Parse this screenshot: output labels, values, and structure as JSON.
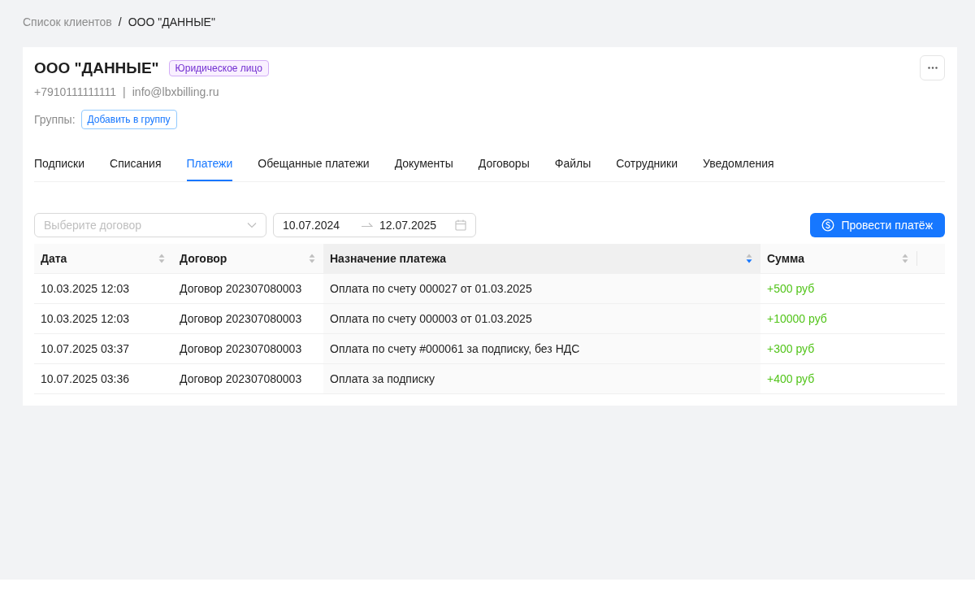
{
  "breadcrumb": {
    "separator": "/",
    "items": [
      {
        "label": "Список клиентов",
        "current": false
      },
      {
        "label": "ООО \"ДАННЫЕ\"",
        "current": true
      }
    ]
  },
  "client": {
    "name": "ООО \"ДАННЫЕ\"",
    "type_badge": "Юридическое лицо",
    "phone": "+7910111111111",
    "contact_separator": "|",
    "email": "info@lbxbilling.ru",
    "groups_label": "Группы:",
    "add_group_button": "Добавить в группу"
  },
  "tabs": [
    {
      "label": "Подписки",
      "selected": false
    },
    {
      "label": "Списания",
      "selected": false
    },
    {
      "label": "Платежи",
      "selected": true
    },
    {
      "label": "Обещанные платежи",
      "selected": false
    },
    {
      "label": "Документы",
      "selected": false
    },
    {
      "label": "Договоры",
      "selected": false
    },
    {
      "label": "Файлы",
      "selected": false
    },
    {
      "label": "Сотрудники",
      "selected": false
    },
    {
      "label": "Уведомления",
      "selected": false
    }
  ],
  "filters": {
    "contract_select": {
      "placeholder": "Выберите договор"
    },
    "date_range": {
      "start": "10.07.2024",
      "end": "12.07.2025"
    }
  },
  "actions": {
    "make_payment_button": "Провести платёж"
  },
  "table": {
    "columns": [
      {
        "label": "Дата",
        "sorted_ascending": false,
        "sorted_descending": false,
        "kind": "text"
      },
      {
        "label": "Договор",
        "sorted_ascending": false,
        "sorted_descending": false,
        "kind": "text"
      },
      {
        "label": "Назначение платежа",
        "sorted_ascending": false,
        "sorted_descending": true,
        "kind": "text"
      },
      {
        "label": "Сумма",
        "sorted_ascending": false,
        "sorted_descending": false,
        "kind": "money"
      }
    ],
    "rows": [
      [
        "10.03.2025 12:03",
        "Договор 202307080003",
        "Оплата по счету 000027 от 01.03.2025",
        "+500 руб"
      ],
      [
        "10.03.2025 12:03",
        "Договор 202307080003",
        "Оплата по счету 000003 от 01.03.2025",
        "+10000 руб"
      ],
      [
        "10.07.2025 03:37",
        "Договор 202307080003",
        "Оплата по счету #000061 за подписку, без НДС",
        "+300 руб"
      ],
      [
        "10.07.2025 03:36",
        "Договор 202307080003",
        "Оплата за подписку",
        "+400 руб"
      ]
    ]
  }
}
